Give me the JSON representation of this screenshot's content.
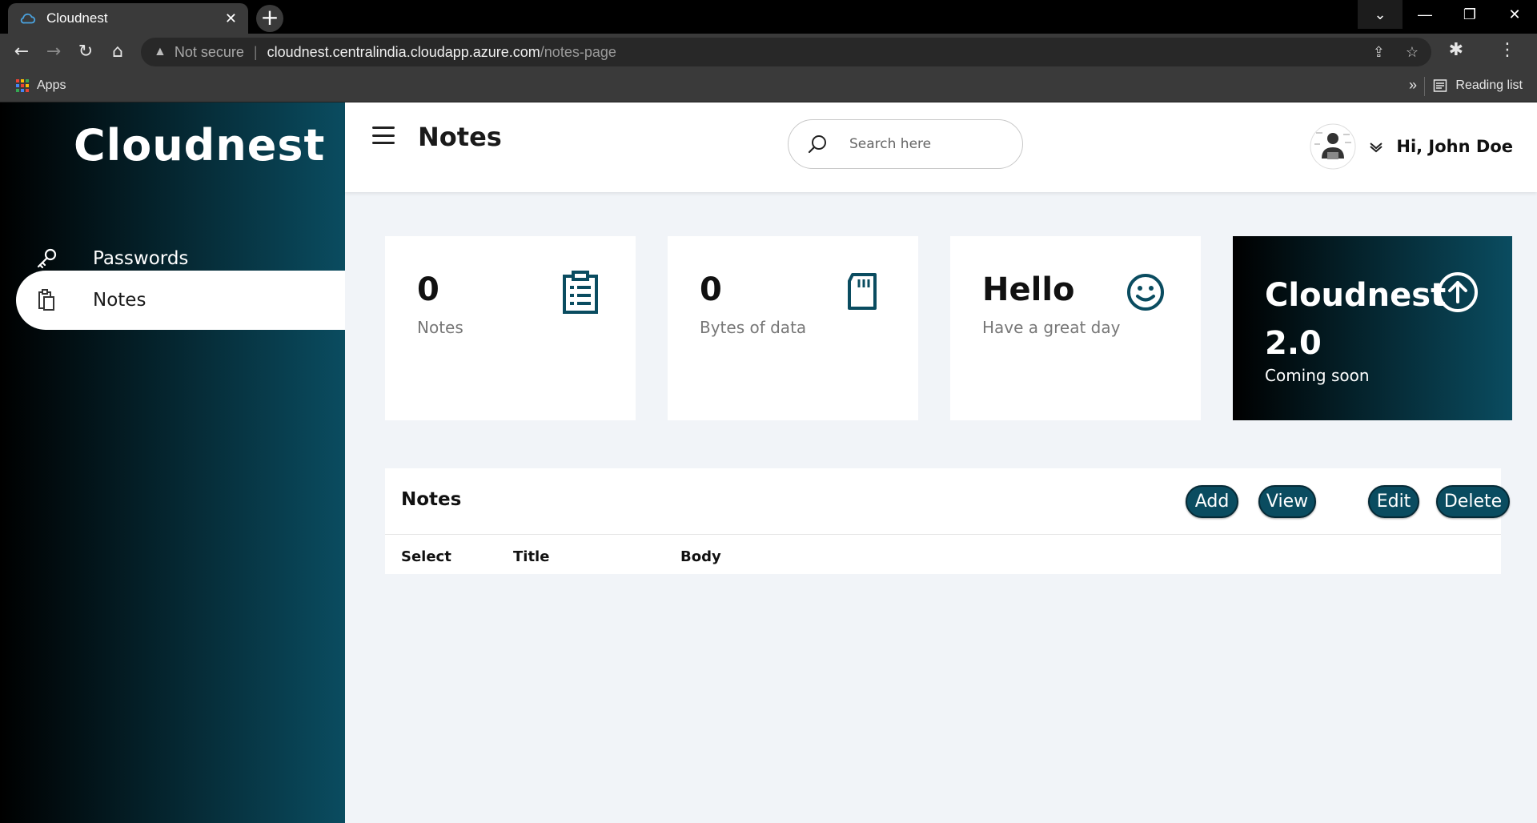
{
  "browser": {
    "tab_title": "Cloudnest",
    "tab_close": "✕",
    "new_tab": "+",
    "not_secure": "Not secure",
    "url_host": "cloudnest.centralindia.cloudapp.azure.com",
    "url_path": "/notes-page",
    "bookmarks": {
      "apps_label": "Apps",
      "more": "»",
      "reading_list": "Reading list"
    }
  },
  "sidebar": {
    "brand": "Cloudnest",
    "items": [
      {
        "label": "Passwords",
        "icon": "key-icon",
        "active": false
      },
      {
        "label": "Notes",
        "icon": "clipboard-icon",
        "active": true
      }
    ]
  },
  "header": {
    "title": "Notes",
    "search_placeholder": "Search here",
    "greeting": "Hi, John Doe"
  },
  "cards": {
    "notes": {
      "value": "0",
      "label": "Notes",
      "icon": "clipboard-list-icon"
    },
    "bytes": {
      "value": "0",
      "label": "Bytes of data",
      "icon": "sd-card-icon"
    },
    "hello": {
      "value": "Hello",
      "label": "Have a great day",
      "icon": "smiley-icon"
    },
    "promo": {
      "title": "Cloudnest 2.0",
      "subtitle": "Coming soon",
      "icon": "arrow-up-circle-icon"
    }
  },
  "notes_panel": {
    "title": "Notes",
    "buttons": {
      "add": "Add",
      "view": "View",
      "edit": "Edit",
      "delete": "Delete"
    },
    "columns": [
      "Select",
      "Title",
      "Body"
    ]
  },
  "colors": {
    "accent": "#0a4c60",
    "sidebar_gradient_start": "#000000",
    "background": "#f1f4f8"
  }
}
